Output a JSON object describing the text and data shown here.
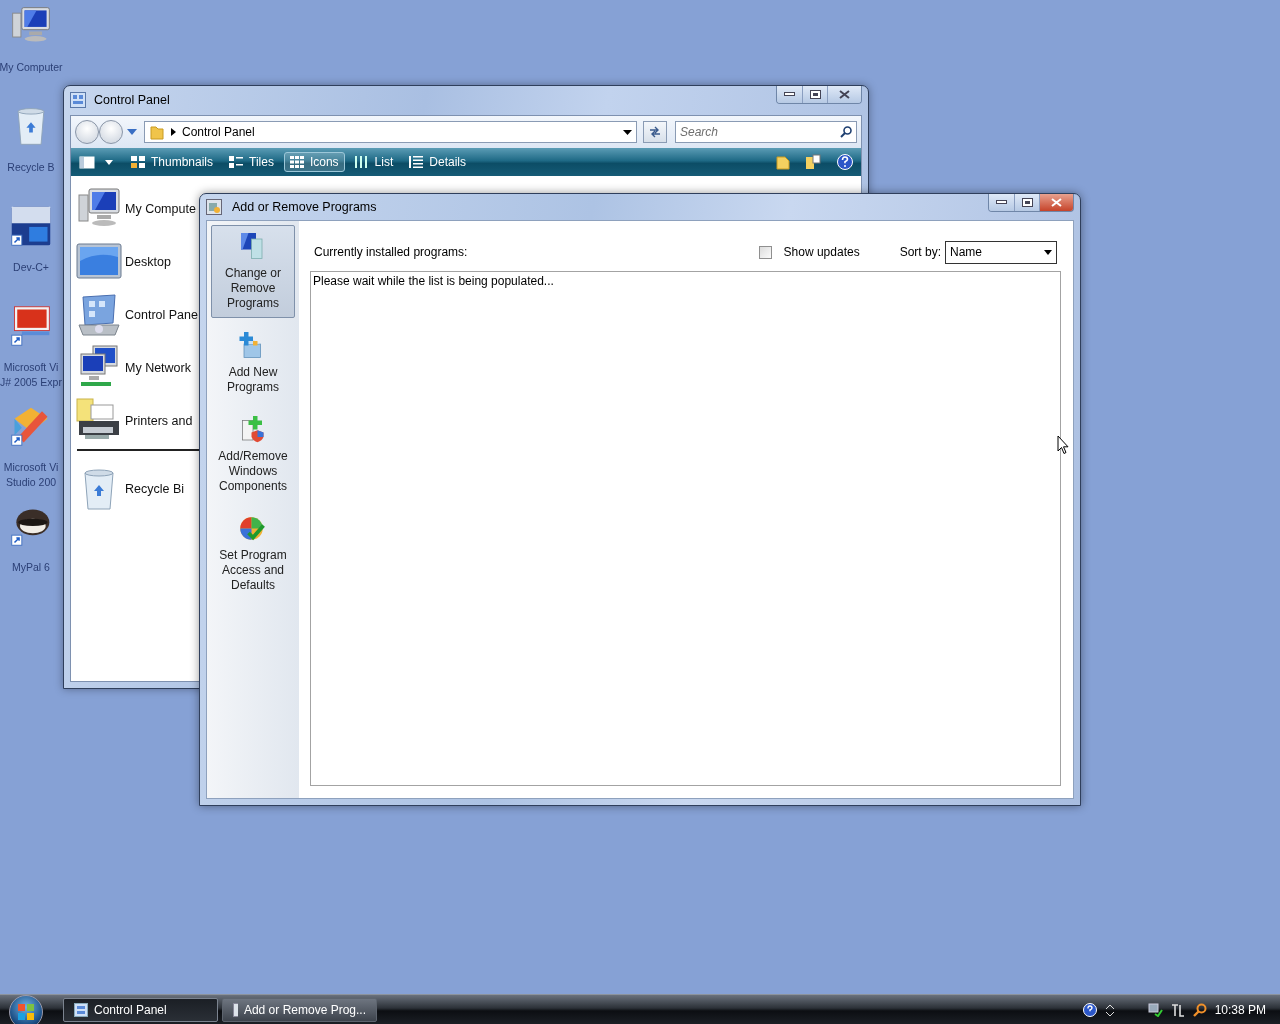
{
  "desktop_icons": [
    {
      "kind": "computer",
      "lines": [
        "My Computer"
      ]
    },
    {
      "kind": "bin",
      "lines": [
        "Recycle B"
      ]
    },
    {
      "kind": "devcpp",
      "lines": [
        "Dev-C+"
      ]
    },
    {
      "kind": "vjsharp",
      "lines": [
        "Microsoft Vi",
        "J# 2005 Expr"
      ]
    },
    {
      "kind": "vstudio",
      "lines": [
        "Microsoft Vi",
        "Studio 200"
      ]
    },
    {
      "kind": "mypal",
      "lines": [
        "MyPal 6"
      ]
    }
  ],
  "control_panel": {
    "title": "Control Panel",
    "address": "Control Panel",
    "search": {
      "placeholder": "Search"
    },
    "views": [
      {
        "kind": "thumbnails",
        "label": "Thumbnails",
        "selected": false
      },
      {
        "kind": "tiles",
        "label": "Tiles",
        "selected": false
      },
      {
        "kind": "icons",
        "label": "Icons",
        "selected": true
      },
      {
        "kind": "list",
        "label": "List",
        "selected": false
      },
      {
        "kind": "details",
        "label": "Details",
        "selected": false
      }
    ],
    "items": [
      {
        "kind": "computer",
        "label": "My Compute",
        "separator_before": false
      },
      {
        "kind": "desktop",
        "label": "Desktop",
        "separator_before": false
      },
      {
        "kind": "panel",
        "label": "Control Pane",
        "separator_before": false
      },
      {
        "kind": "network",
        "label": "My Network",
        "separator_before": false
      },
      {
        "kind": "printer",
        "label": "Printers and",
        "separator_before": false
      },
      {
        "kind": "bin",
        "label": "Recycle Bi",
        "separator_before": true
      }
    ]
  },
  "dialog": {
    "title": "Add or Remove Programs",
    "nav": [
      {
        "kind": "change",
        "lines": [
          "Change or",
          "Remove",
          "Programs"
        ],
        "selected": true
      },
      {
        "kind": "add",
        "lines": [
          "Add New",
          "Programs"
        ],
        "selected": false
      },
      {
        "kind": "windows",
        "lines": [
          "Add/Remove",
          "Windows",
          "Components"
        ],
        "selected": false
      },
      {
        "kind": "defaults",
        "lines": [
          "Set Program",
          "Access and",
          "Defaults"
        ],
        "selected": false
      }
    ],
    "installed_label": "Currently installed programs:",
    "show_updates": {
      "label": "Show updates",
      "checked": false
    },
    "sort_label": "Sort by:",
    "sort_value": "Name",
    "list_message": "Please wait while the list is being populated..."
  },
  "taskbar": {
    "buttons": [
      {
        "kind": "panel",
        "label": "Control Panel",
        "selected": true
      },
      {
        "kind": "dialog",
        "label": "Add or Remove Prog...",
        "selected": false
      }
    ],
    "clock": "10:38 PM"
  }
}
